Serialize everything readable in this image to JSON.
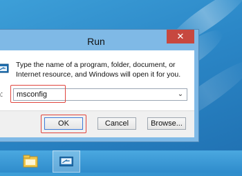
{
  "dialog": {
    "title": "Run",
    "close_glyph": "✕",
    "description": "Type the name of a program, folder, document, or Internet resource, and Windows will open it for you.",
    "open_label": "n:",
    "open_value": "msconfig",
    "dropdown_glyph": "⌄",
    "buttons": {
      "ok": "OK",
      "cancel": "Cancel",
      "browse": "Browse..."
    }
  },
  "taskbar": {
    "items": [
      {
        "name": "file-explorer-icon"
      },
      {
        "name": "run-dialog-icon"
      }
    ]
  },
  "colors": {
    "highlight": "#e0443d",
    "close_button": "#c7483f",
    "desktop": "#2b87c7"
  }
}
